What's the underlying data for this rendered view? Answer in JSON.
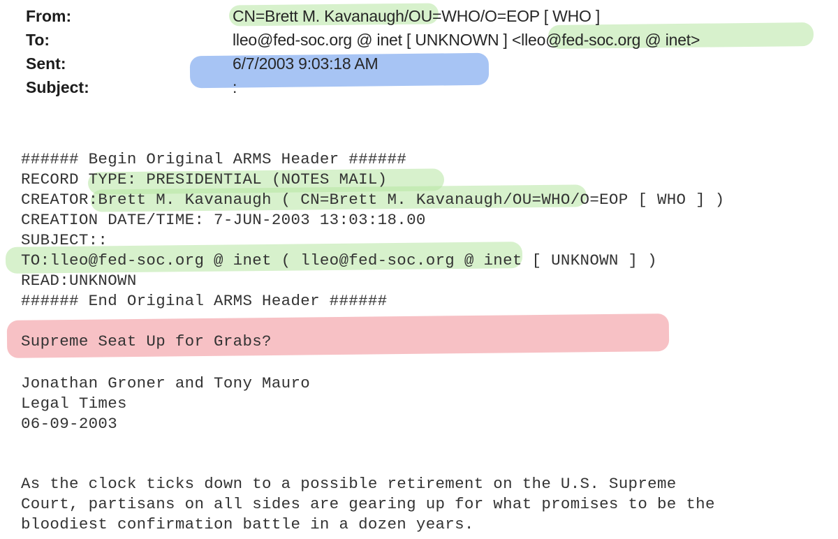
{
  "headers": [
    {
      "label": "From:",
      "value": "CN=Brett M. Kavanaugh/OU=WHO/O=EOP [ WHO ]"
    },
    {
      "label": "To:",
      "value": "lleo@fed-soc.org @ inet [ UNKNOWN ] <lleo@fed-soc.org @ inet>"
    },
    {
      "label": "Sent:",
      "value": "6/7/2003 9:03:18 AM"
    },
    {
      "label": "Subject:",
      "value": ":"
    }
  ],
  "arms_header": [
    "###### Begin Original ARMS Header ######",
    "RECORD TYPE: PRESIDENTIAL (NOTES MAIL)",
    "CREATOR:Brett M. Kavanaugh ( CN=Brett M. Kavanaugh/OU=WHO/O=EOP [ WHO ] )",
    "CREATION DATE/TIME: 7-JUN-2003 13:03:18.00",
    "SUBJECT::",
    "TO:lleo@fed-soc.org @ inet ( lleo@fed-soc.org @ inet [ UNKNOWN ] )",
    "READ:UNKNOWN",
    "###### End Original ARMS Header ######"
  ],
  "article": {
    "headline": "Supreme Seat Up for Grabs?",
    "byline": [
      "Jonathan Groner and Tony Mauro",
      "Legal Times",
      "06-09-2003"
    ],
    "body": [
      "As the clock ticks down to a possible retirement on the U.S. Supreme",
      "Court, partisans on all sides are gearing up for what promises to be the",
      "bloodiest confirmation battle in a dozen years."
    ]
  },
  "highlight_colors": {
    "green": "#b6e6a3",
    "blue": "#8ab0f0",
    "red": "#f4a7ac"
  }
}
